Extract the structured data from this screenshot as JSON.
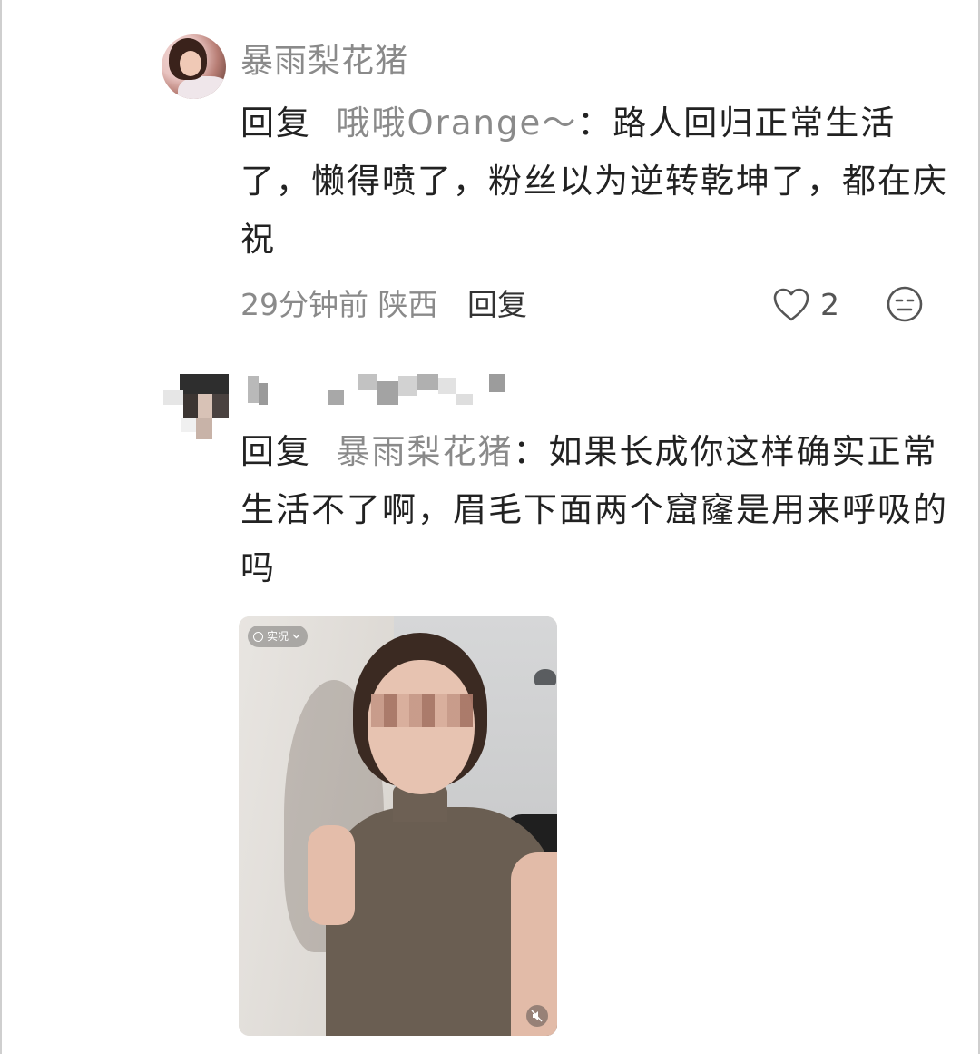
{
  "comments": [
    {
      "username": "暴雨梨花猪",
      "reply_word": "回复",
      "reply_target": "哦哦Orange～",
      "separator": "：",
      "content": "路人回归正常生活了，懒得喷了，粉丝以为逆转乾坤了，都在庆祝",
      "time": "29分钟前",
      "location": "陕西",
      "reply_label": "回复",
      "like_count": "2",
      "icons": {
        "like": "heart-icon",
        "emoji": "emoji-icon"
      }
    },
    {
      "username_obscured": true,
      "reply_word": "回复",
      "reply_target": "暴雨梨花猪",
      "separator": "：",
      "content": "如果长成你这样确实正常生活不了啊，眉毛下面两个窟窿是用来呼吸的吗",
      "image": {
        "badge_label": "实况",
        "icons": {
          "live": "live-photo-icon",
          "badge_arrow": "chevron-down-icon",
          "sound": "mute-icon"
        }
      }
    }
  ]
}
